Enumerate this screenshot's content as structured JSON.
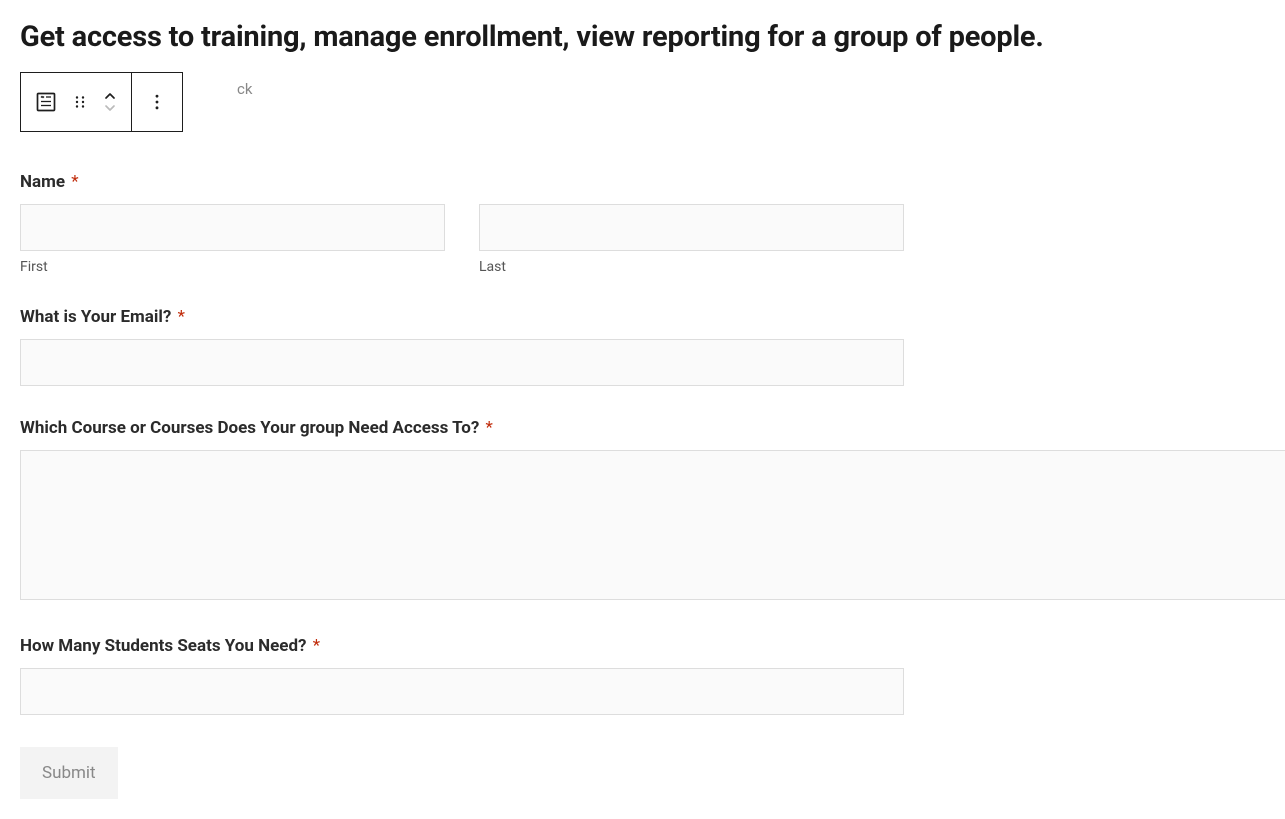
{
  "heading": "Get access to training, manage enrollment, view reporting for a group of people.",
  "toolbar": {
    "fragment_text": "ck"
  },
  "form": {
    "name": {
      "label": "Name",
      "first_sublabel": "First",
      "last_sublabel": "Last",
      "first_value": "",
      "last_value": ""
    },
    "email": {
      "label": "What is Your Email?",
      "value": ""
    },
    "courses": {
      "label": "Which Course or Courses Does Your group Need Access To?",
      "value": ""
    },
    "seats": {
      "label": "How Many Students Seats You Need?",
      "value": ""
    },
    "required_mark": "*",
    "submit_label": "Submit"
  }
}
